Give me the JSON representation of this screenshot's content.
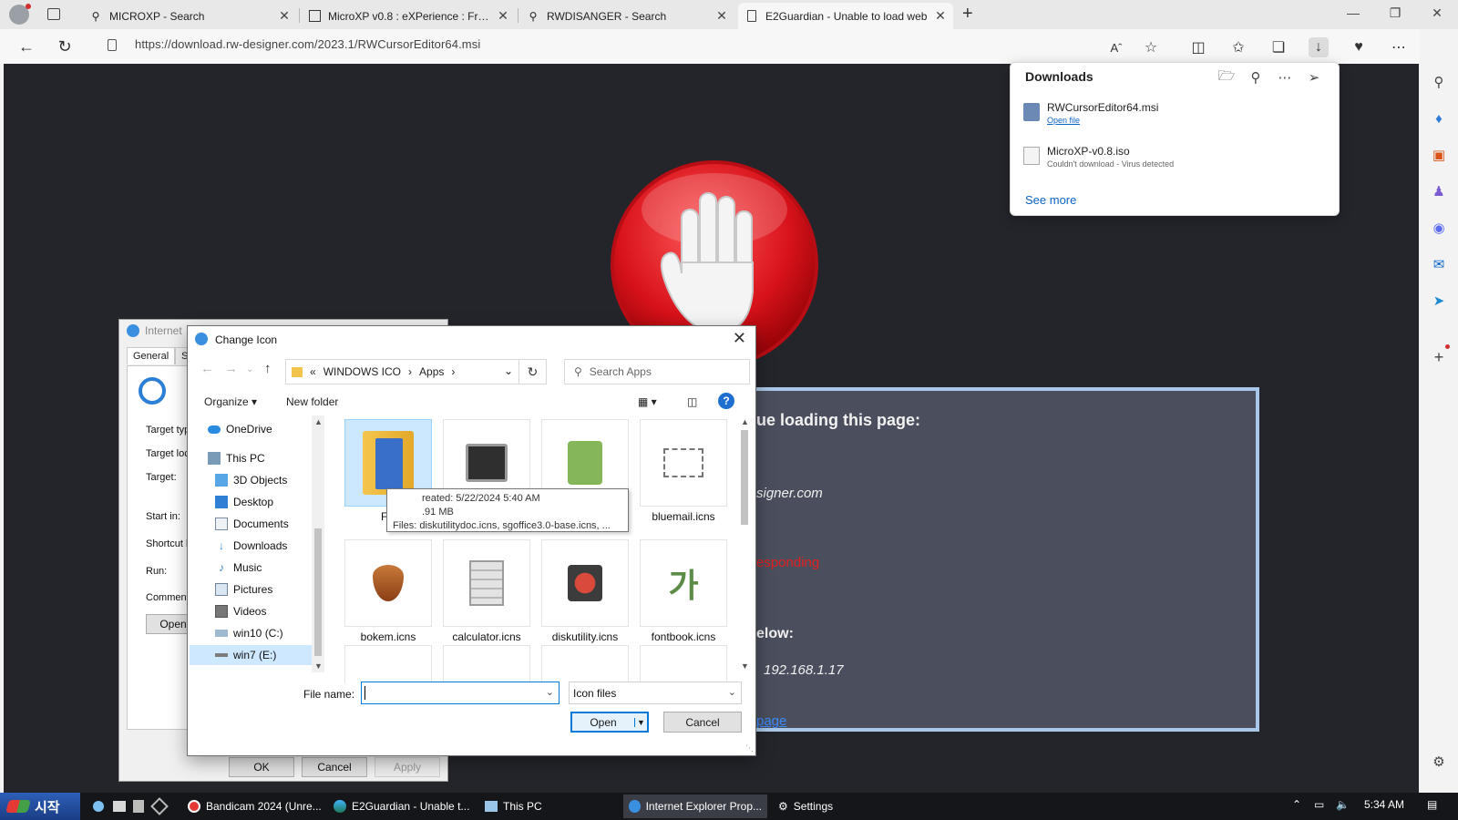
{
  "browser": {
    "tabs": [
      {
        "title": "MICROXP - Search",
        "icon": "search-icon"
      },
      {
        "title": "MicroXP v0.8 : eXPerience : Free (",
        "icon": "site-icon"
      },
      {
        "title": "RWDISANGER - Search",
        "icon": "search-icon"
      },
      {
        "title": "E2Guardian - Unable to load web",
        "icon": "page-icon"
      }
    ],
    "url": "https://download.rw-designer.com/2023.1/RWCursorEditor64.msi"
  },
  "blocked_page": {
    "heading": "ue loading this page:",
    "site": "signer.com",
    "reason": "esponding",
    "below": "elow:",
    "ip": "192.168.1.17",
    "link": "page"
  },
  "downloads": {
    "title": "Downloads",
    "items": [
      {
        "name": "RWCursorEditor64.msi",
        "sub": "Open file"
      },
      {
        "name": "MicroXP-v0.8.iso",
        "sub": "Couldn't download - Virus detected"
      }
    ],
    "see_more": "See more"
  },
  "ie_properties": {
    "title": "Internet",
    "tabs": [
      "General",
      "Sh"
    ],
    "labels": [
      "Target typ",
      "Target loc",
      "Target:",
      "Start in:",
      "Shortcut k",
      "Run:",
      "Comment:"
    ],
    "open_btn": "Open",
    "ok": "OK",
    "cancel": "Cancel",
    "apply": "Apply"
  },
  "change_icon": {
    "title": "Change Icon",
    "breadcrumb": [
      "«",
      "WINDOWS ICO",
      "Apps"
    ],
    "search_placeholder": "Search Apps",
    "organize": "Organize",
    "new_folder": "New folder",
    "tree": [
      "OneDrive",
      "This PC",
      "3D Objects",
      "Desktop",
      "Documents",
      "Downloads",
      "Music",
      "Pictures",
      "Videos",
      "win10 (C:)",
      "win7 (E:)"
    ],
    "files": [
      {
        "label": "F",
        "icon": "folder-icon"
      },
      {
        "label": "cns",
        "icon": "activity-monitor-icon"
      },
      {
        "label": "",
        "icon": "address-book-icon"
      },
      {
        "label": "bluemail.icns",
        "icon": "bluemail-icon"
      },
      {
        "label": "bokem.icns",
        "icon": "bokem-icon"
      },
      {
        "label": "calculator.icns",
        "icon": "calculator-icon"
      },
      {
        "label": "diskutility.icns",
        "icon": "disk-utility-icon"
      },
      {
        "label": "fontbook.icns",
        "icon": "font-book-icon"
      }
    ],
    "tooltip": [
      "reated: 5/22/2024 5:40 AM",
      ".91 MB",
      "Files: diskutilitydoc.icns, sgoffice3.0-base.icns, ..."
    ],
    "file_name_label": "File name:",
    "file_name_value": "",
    "file_type": "Icon files",
    "open": "Open",
    "cancel": "Cancel"
  },
  "taskbar": {
    "start": "시작",
    "apps": [
      "Bandicam 2024 (Unre...",
      "E2Guardian - Unable t...",
      "This PC",
      "Internet Explorer Prop...",
      "Settings"
    ],
    "time": "5:34 AM"
  },
  "colors": {
    "accent": "#0078d7",
    "stop_red": "#d8121a",
    "page_bg": "#24252b"
  }
}
